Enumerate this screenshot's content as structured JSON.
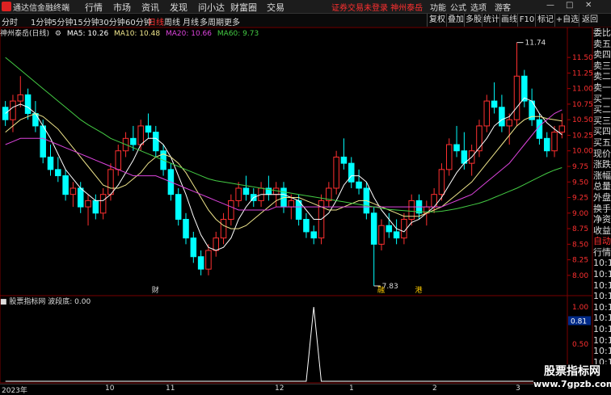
{
  "app": {
    "title": "通达信金融终端"
  },
  "menu": [
    "行情",
    "市场",
    "资讯",
    "发现",
    "问小达",
    "财富圈",
    "交易"
  ],
  "notice": "证券交易未登录 神州泰岳",
  "right_menu": [
    "功能",
    "公式",
    "选项",
    "游客"
  ],
  "period_tabs": [
    "分时",
    "1分钟",
    "5分钟",
    "15分钟",
    "30分钟",
    "60分钟",
    "日线",
    "周线",
    "月线",
    "多周期",
    "更多"
  ],
  "active_tab": "日线",
  "right_tools": [
    "复权",
    "叠加",
    "多股",
    "统计",
    "画线",
    "F10",
    "标记",
    "+自选",
    "返回"
  ],
  "stock": {
    "name": "神州泰岳(日线)"
  },
  "ma": [
    {
      "label": "MA5: 10.26",
      "color": "#ffffff"
    },
    {
      "label": "MA10: 10.48",
      "color": "#f0e68c"
    },
    {
      "label": "MA20: 10.66",
      "color": "#dd44dd"
    },
    {
      "label": "MA60: 9.73",
      "color": "#44cc44"
    }
  ],
  "price_axis": [
    "11.50",
    "11.25",
    "11.00",
    "10.75",
    "10.50",
    "10.25",
    "10.00",
    "9.75",
    "9.50",
    "9.25",
    "9.00",
    "8.75",
    "8.50",
    "8.25",
    "8.00"
  ],
  "annotations": {
    "high": "11.74",
    "low": "7.83",
    "markers": [
      "财",
      "融",
      "港"
    ]
  },
  "sidebar": [
    "委比",
    "卖五",
    "卖四",
    "卖三",
    "卖二",
    "卖一",
    "买一",
    "买二",
    "买三",
    "买四",
    "买五",
    "现价",
    "涨跌",
    "涨幅",
    "总量",
    "外盘",
    "换手",
    "净资",
    "收益",
    "自动",
    "行情",
    "10:1",
    "10:1",
    "10:1",
    "10:1",
    "10:1",
    "10:1",
    "10:1",
    "10:1",
    "10:1",
    "10:1",
    "10:1"
  ],
  "sidebar_red_index": 19,
  "indicator": {
    "name": "股票指标网",
    "label": "波段底: 0.00",
    "axis": [
      "1.00",
      "0.81",
      "0.50"
    ],
    "marker": "0.81"
  },
  "dates": [
    "2023年",
    "10",
    "11",
    "12",
    "1",
    "2",
    "3"
  ],
  "watermark": {
    "line1": "股票指标网",
    "line2": "www.7gpzb.com"
  },
  "chart_data": {
    "type": "candlestick",
    "ylim": [
      7.7,
      11.8
    ],
    "candles": [
      [
        10.7,
        10.8,
        10.4,
        10.5
      ],
      [
        10.5,
        10.9,
        10.3,
        10.8
      ],
      [
        10.8,
        11.2,
        10.7,
        10.9
      ],
      [
        10.9,
        11.0,
        10.5,
        10.6
      ],
      [
        10.6,
        10.8,
        10.3,
        10.4
      ],
      [
        10.4,
        10.5,
        9.8,
        9.9
      ],
      [
        9.9,
        10.1,
        9.6,
        9.7
      ],
      [
        9.7,
        9.9,
        9.5,
        9.6
      ],
      [
        9.6,
        9.7,
        9.2,
        9.3
      ],
      [
        9.3,
        9.5,
        9.1,
        9.4
      ],
      [
        9.4,
        9.5,
        9.0,
        9.1
      ],
      [
        9.1,
        9.3,
        8.8,
        9.2
      ],
      [
        9.2,
        9.3,
        8.9,
        9.0
      ],
      [
        9.0,
        9.4,
        8.9,
        9.3
      ],
      [
        9.3,
        9.8,
        9.2,
        9.7
      ],
      [
        9.7,
        10.1,
        9.6,
        10.0
      ],
      [
        10.0,
        10.3,
        9.9,
        10.2
      ],
      [
        10.2,
        10.4,
        10.0,
        10.1
      ],
      [
        10.1,
        10.5,
        10.0,
        10.4
      ],
      [
        10.4,
        10.6,
        10.2,
        10.3
      ],
      [
        10.3,
        10.4,
        9.9,
        10.0
      ],
      [
        10.0,
        10.1,
        9.6,
        9.7
      ],
      [
        9.7,
        9.8,
        9.2,
        9.3
      ],
      [
        9.3,
        9.4,
        8.8,
        8.9
      ],
      [
        8.9,
        9.0,
        8.5,
        8.6
      ],
      [
        8.6,
        8.7,
        8.2,
        8.3
      ],
      [
        8.3,
        8.4,
        8.0,
        8.1
      ],
      [
        8.1,
        8.5,
        8.0,
        8.4
      ],
      [
        8.4,
        8.7,
        8.3,
        8.6
      ],
      [
        8.6,
        9.0,
        8.5,
        8.9
      ],
      [
        8.9,
        9.3,
        8.8,
        9.2
      ],
      [
        9.2,
        9.5,
        9.1,
        9.4
      ],
      [
        9.4,
        9.6,
        9.2,
        9.3
      ],
      [
        9.3,
        9.4,
        9.1,
        9.2
      ],
      [
        9.2,
        9.5,
        9.1,
        9.4
      ],
      [
        9.4,
        9.6,
        9.2,
        9.3
      ],
      [
        9.3,
        9.5,
        9.1,
        9.4
      ],
      [
        9.4,
        9.5,
        9.0,
        9.1
      ],
      [
        9.1,
        9.3,
        8.9,
        9.2
      ],
      [
        9.2,
        9.3,
        8.8,
        8.9
      ],
      [
        8.9,
        9.0,
        8.6,
        8.7
      ],
      [
        8.7,
        8.8,
        8.5,
        8.6
      ],
      [
        8.6,
        9.3,
        8.5,
        9.2
      ],
      [
        9.2,
        9.5,
        9.1,
        9.4
      ],
      [
        9.4,
        10.0,
        9.3,
        9.9
      ],
      [
        9.9,
        10.2,
        9.7,
        9.8
      ],
      [
        9.8,
        9.9,
        9.4,
        9.5
      ],
      [
        9.5,
        9.7,
        9.3,
        9.4
      ],
      [
        9.4,
        9.5,
        8.9,
        9.0
      ],
      [
        9.0,
        9.1,
        7.83,
        8.5
      ],
      [
        8.5,
        8.9,
        8.4,
        8.8
      ],
      [
        8.8,
        9.0,
        8.6,
        8.7
      ],
      [
        8.7,
        8.9,
        8.5,
        8.6
      ],
      [
        8.6,
        9.0,
        8.5,
        8.9
      ],
      [
        8.9,
        9.3,
        8.8,
        9.2
      ],
      [
        9.2,
        9.3,
        8.9,
        9.0
      ],
      [
        9.0,
        9.2,
        8.8,
        9.1
      ],
      [
        9.1,
        9.4,
        9.0,
        9.3
      ],
      [
        9.3,
        9.8,
        9.2,
        9.7
      ],
      [
        9.7,
        10.2,
        9.6,
        10.1
      ],
      [
        10.1,
        10.4,
        9.9,
        10.0
      ],
      [
        10.0,
        10.3,
        9.7,
        9.8
      ],
      [
        9.8,
        10.1,
        9.6,
        10.0
      ],
      [
        10.0,
        10.5,
        9.9,
        10.4
      ],
      [
        10.4,
        10.9,
        10.3,
        10.8
      ],
      [
        10.8,
        11.1,
        10.6,
        10.7
      ],
      [
        10.7,
        10.9,
        10.3,
        10.4
      ],
      [
        10.4,
        10.6,
        10.1,
        10.5
      ],
      [
        10.5,
        11.74,
        10.4,
        11.2
      ],
      [
        11.2,
        11.3,
        10.7,
        10.8
      ],
      [
        10.8,
        11.0,
        10.4,
        10.5
      ],
      [
        10.5,
        10.6,
        10.1,
        10.2
      ],
      [
        10.2,
        10.3,
        9.9,
        10.0
      ],
      [
        10.0,
        10.4,
        9.9,
        10.3
      ],
      [
        10.3,
        10.6,
        10.2,
        10.4
      ]
    ],
    "ma_series": [
      {
        "name": "MA5",
        "values": [
          10.6,
          10.7,
          10.75,
          10.7,
          10.6,
          10.4,
          10.2,
          9.95,
          9.7,
          9.55,
          9.4,
          9.3,
          9.2,
          9.2,
          9.3,
          9.45,
          9.65,
          9.85,
          10.1,
          10.2,
          10.2,
          10.1,
          9.9,
          9.6,
          9.3,
          8.95,
          8.65,
          8.45,
          8.4,
          8.45,
          8.6,
          8.9,
          9.1,
          9.25,
          9.3,
          9.3,
          9.3,
          9.3,
          9.25,
          9.2,
          9.05,
          8.9,
          8.9,
          9.0,
          9.2,
          9.45,
          9.6,
          9.6,
          9.5,
          9.25,
          9.05,
          8.9,
          8.75,
          8.7,
          8.85,
          8.9,
          9.0,
          9.1,
          9.25,
          9.45,
          9.65,
          9.8,
          9.9,
          10.05,
          10.2,
          10.4,
          10.5,
          10.55,
          10.7,
          10.85,
          10.8,
          10.6,
          10.45,
          10.35,
          10.26
        ]
      },
      {
        "name": "MA10",
        "values": [
          10.3,
          10.4,
          10.5,
          10.55,
          10.6,
          10.55,
          10.45,
          10.35,
          10.2,
          10.05,
          9.9,
          9.75,
          9.6,
          9.45,
          9.4,
          9.4,
          9.45,
          9.55,
          9.65,
          9.8,
          9.9,
          9.95,
          9.9,
          9.8,
          9.65,
          9.45,
          9.25,
          9.05,
          8.9,
          8.8,
          8.75,
          8.75,
          8.8,
          8.9,
          9.0,
          9.1,
          9.2,
          9.25,
          9.25,
          9.25,
          9.2,
          9.15,
          9.1,
          9.05,
          9.05,
          9.1,
          9.15,
          9.2,
          9.2,
          9.15,
          9.1,
          9.05,
          9.0,
          8.95,
          8.95,
          8.95,
          9.0,
          9.05,
          9.1,
          9.2,
          9.3,
          9.4,
          9.5,
          9.65,
          9.8,
          9.95,
          10.1,
          10.25,
          10.4,
          10.5,
          10.55,
          10.55,
          10.52,
          10.5,
          10.48
        ]
      },
      {
        "name": "MA20",
        "values": [
          10.1,
          10.15,
          10.2,
          10.2,
          10.2,
          10.2,
          10.15,
          10.1,
          10.05,
          10.0,
          9.95,
          9.9,
          9.85,
          9.8,
          9.75,
          9.7,
          9.65,
          9.6,
          9.6,
          9.6,
          9.6,
          9.55,
          9.5,
          9.45,
          9.4,
          9.35,
          9.3,
          9.25,
          9.2,
          9.15,
          9.1,
          9.05,
          9.05,
          9.05,
          9.05,
          9.05,
          9.1,
          9.1,
          9.1,
          9.1,
          9.1,
          9.1,
          9.1,
          9.1,
          9.1,
          9.1,
          9.1,
          9.1,
          9.1,
          9.1,
          9.1,
          9.1,
          9.1,
          9.1,
          9.1,
          9.1,
          9.1,
          9.1,
          9.1,
          9.15,
          9.2,
          9.25,
          9.3,
          9.4,
          9.5,
          9.6,
          9.7,
          9.8,
          9.95,
          10.1,
          10.25,
          10.4,
          10.5,
          10.6,
          10.66
        ]
      },
      {
        "name": "MA60",
        "values": [
          11.5,
          11.4,
          11.3,
          11.2,
          11.1,
          11.0,
          10.9,
          10.8,
          10.7,
          10.6,
          10.5,
          10.42,
          10.35,
          10.28,
          10.2,
          10.15,
          10.1,
          10.05,
          10.0,
          9.95,
          9.9,
          9.85,
          9.8,
          9.75,
          9.7,
          9.65,
          9.6,
          9.55,
          9.52,
          9.5,
          9.48,
          9.46,
          9.44,
          9.42,
          9.4,
          9.38,
          9.36,
          9.34,
          9.32,
          9.3,
          9.28,
          9.26,
          9.24,
          9.22,
          9.2,
          9.18,
          9.16,
          9.14,
          9.12,
          9.1,
          9.08,
          9.06,
          9.05,
          9.04,
          9.03,
          9.02,
          9.02,
          9.02,
          9.03,
          9.05,
          9.07,
          9.1,
          9.13,
          9.16,
          9.2,
          9.25,
          9.3,
          9.35,
          9.4,
          9.46,
          9.52,
          9.58,
          9.64,
          9.69,
          9.73
        ]
      }
    ],
    "indicator_spike_index": 41
  }
}
